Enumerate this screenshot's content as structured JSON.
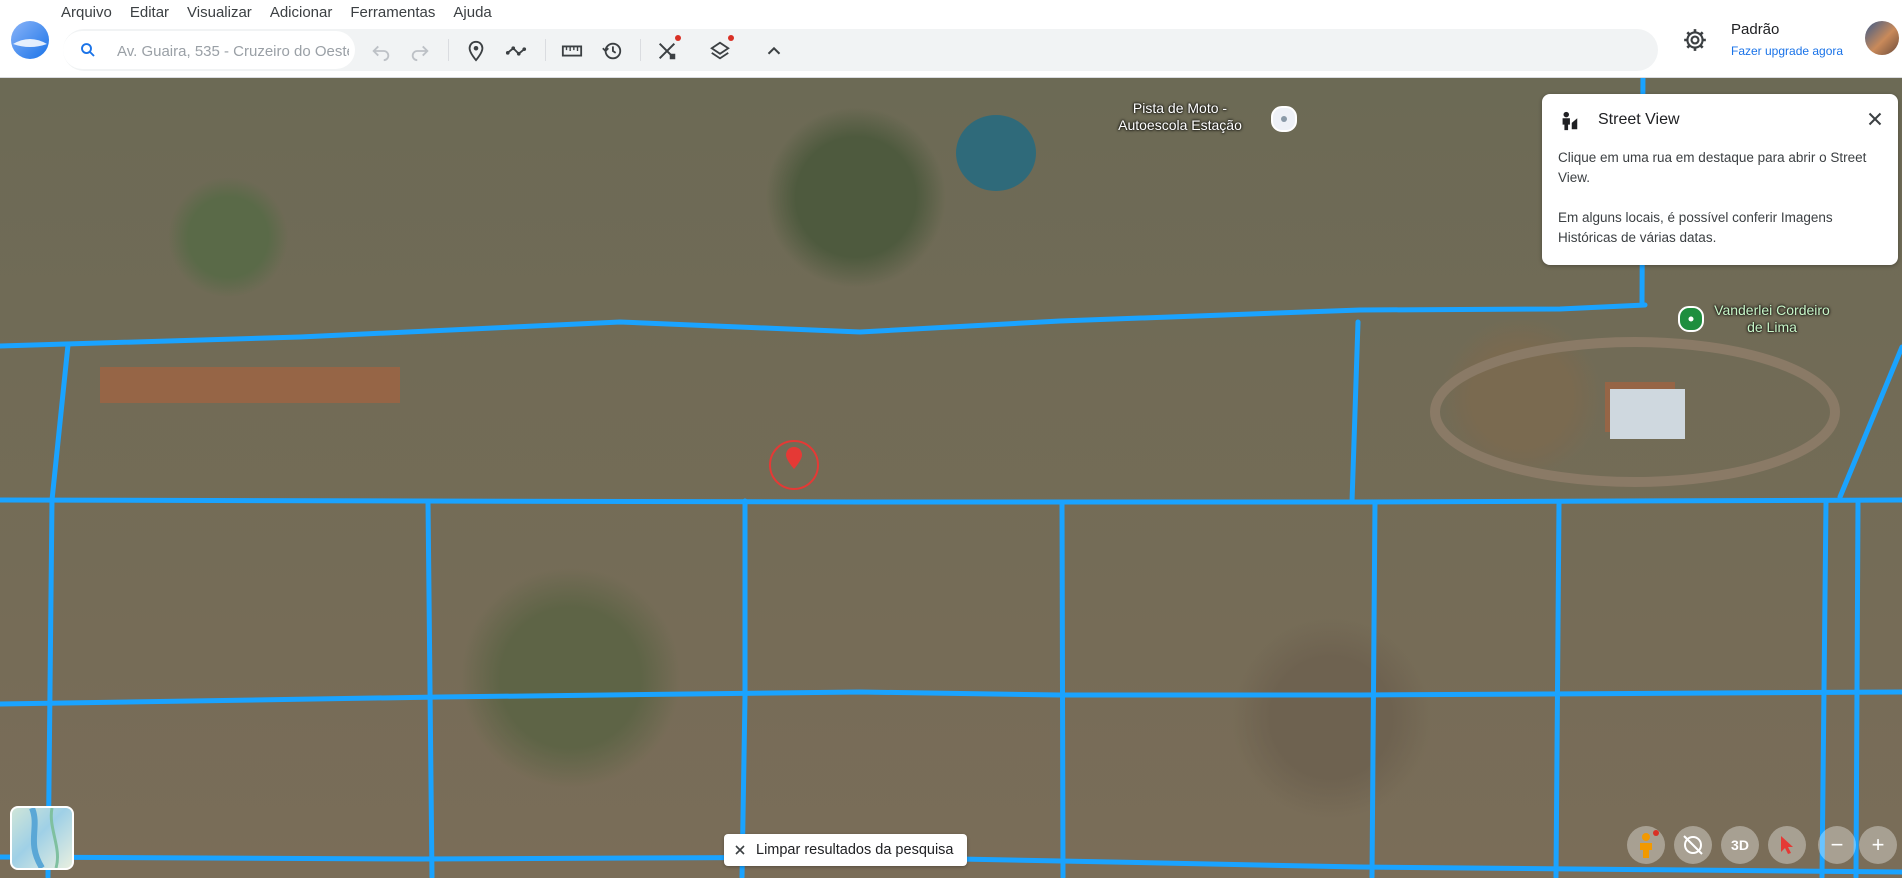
{
  "menu": [
    "Arquivo",
    "Editar",
    "Visualizar",
    "Adicionar",
    "Ferramentas",
    "Ajuda"
  ],
  "search": {
    "value": "",
    "placeholder": "Av. Guaira, 535 - Cruzeiro do Oeste"
  },
  "toolbar": {
    "icons": [
      "undo-icon",
      "redo-icon",
      "placemark-icon",
      "path-icon",
      "ruler-icon",
      "history-icon",
      "satellite-tools-icon",
      "layers-icon",
      "chevron-up-icon"
    ]
  },
  "profile": {
    "name": "Padrão",
    "upgrade": "Fazer upgrade agora"
  },
  "street_view": {
    "title": "Street View",
    "p1": "Clique em uma rua em destaque para abrir o Street View.",
    "p2": "Em alguns locais, é possível conferir Imagens Históricas de várias datas."
  },
  "map": {
    "labels": {
      "moto": "Pista de Moto - Autoescola Estação",
      "vanderlei": "Vanderlei Cordeiro de Lima"
    },
    "road_color": "#1aa3ff"
  },
  "bottom": {
    "clear": "Limpar resultados da pesquisa",
    "controls": [
      "pegman-icon",
      "compass-icon",
      "3D",
      "cursor-icon",
      "−",
      "+"
    ]
  }
}
